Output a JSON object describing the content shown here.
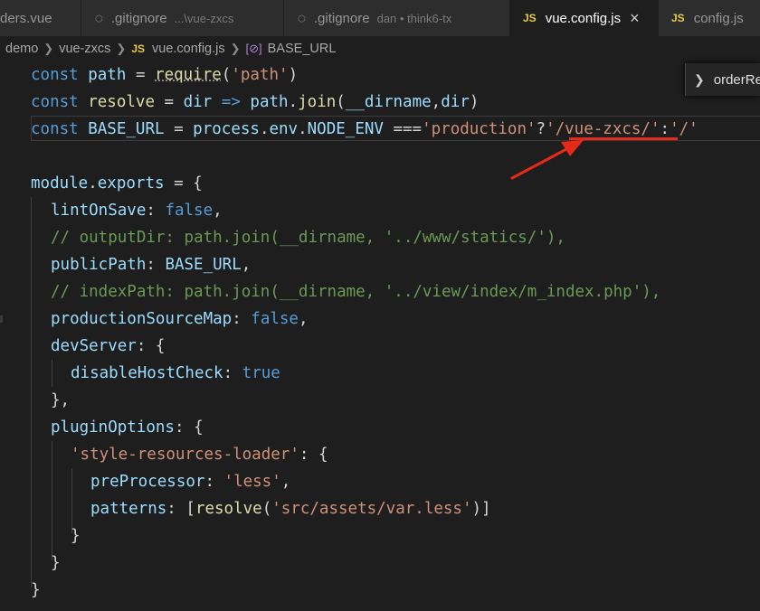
{
  "tabs": [
    {
      "label": "ders.vue",
      "desc": ""
    },
    {
      "label": ".gitignore",
      "desc": "...\\vue-zxcs"
    },
    {
      "label": ".gitignore",
      "desc": "dan • think6-tx"
    },
    {
      "label": "vue.config.js",
      "desc": "",
      "icon": "JS"
    },
    {
      "label": "config.js",
      "desc": "",
      "icon": "JS"
    }
  ],
  "active_tab_close": "×",
  "breadcrumb": {
    "parts": [
      "demo",
      "vue-zxcs",
      "vue.config.js",
      "BASE_URL"
    ],
    "js_icon": "JS",
    "symbol_icon": "[⊘]"
  },
  "peek": {
    "label": "orderRe"
  },
  "colors": {
    "background": "#1e1e1e",
    "keyword": "#569cd6",
    "string": "#ce9178",
    "comment": "#6a9955",
    "annotation": "#e52a1a"
  },
  "code": {
    "l1": {
      "t1": "const",
      "t2": "path",
      "t3": "=",
      "t4": "require",
      "t5": "(",
      "t6": "'path'",
      "t7": ")"
    },
    "l2": {
      "t1": "const",
      "t2": "resolve",
      "t3": "=",
      "t4": "dir",
      "t5": "=>",
      "t6": "path",
      "t7": ".",
      "t8": "join",
      "t9": "(",
      "t10": "__dirname",
      "t11": ",",
      "t12": "dir",
      "t13": ")"
    },
    "l3": {
      "t1": "const",
      "t2": "BASE_URL",
      "t3": "=",
      "t4": "process",
      "t5": ".",
      "t6": "env",
      "t7": ".",
      "t8": "NODE_ENV",
      "t9": "===",
      "t10": "'production'",
      "t11": "?",
      "t12": "'/vue-zxcs/'",
      "t13": ":",
      "t14": "'/'"
    },
    "l5": {
      "t1": "module",
      "t2": ".",
      "t3": "exports",
      "t4": "= {"
    },
    "l6": {
      "t1": "lintOnSave",
      "t2": ":",
      "t3": "false",
      "t4": ","
    },
    "l7": {
      "t1": "// outputDir: path.join(__dirname, '../www/statics/'),"
    },
    "l8": {
      "t1": "publicPath",
      "t2": ":",
      "t3": "BASE_URL",
      "t4": ","
    },
    "l9": {
      "t1": "// indexPath: path.join(__dirname, '../view/index/m_index.php'),"
    },
    "l10": {
      "t1": "productionSourceMap",
      "t2": ":",
      "t3": "false",
      "t4": ","
    },
    "l11": {
      "t1": "devServer",
      "t2": ":",
      "t3": "{"
    },
    "l12": {
      "t1": "disableHostCheck",
      "t2": ":",
      "t3": "true"
    },
    "l13": {
      "t1": "},"
    },
    "l14": {
      "t1": "pluginOptions",
      "t2": ":",
      "t3": "{"
    },
    "l15": {
      "t1": "'style-resources-loader'",
      "t2": ": {"
    },
    "l16": {
      "t1": "preProcessor",
      "t2": ":",
      "t3": "'less'",
      "t4": ","
    },
    "l17": {
      "t1": "patterns",
      "t2": ":",
      "t3": "[",
      "t4": "resolve",
      "t5": "(",
      "t6": "'src/assets/var.less'",
      "t7": ")]"
    },
    "l18": {
      "t1": "}"
    },
    "l19": {
      "t1": "}"
    },
    "l20": {
      "t1": "}"
    }
  }
}
